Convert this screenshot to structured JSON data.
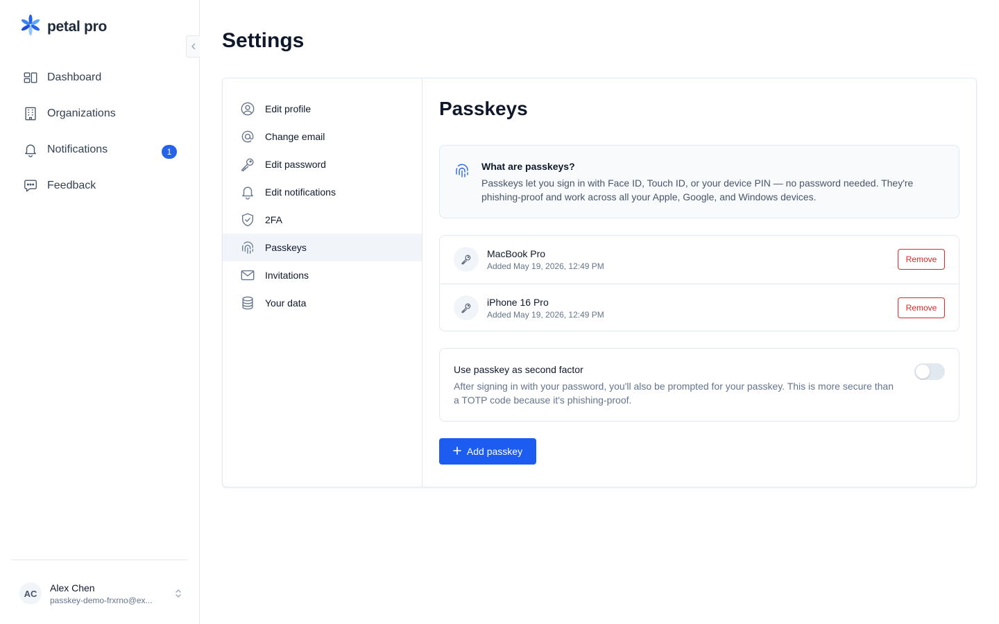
{
  "brand": {
    "name": "petal pro"
  },
  "sidebar": {
    "items": [
      {
        "label": "Dashboard",
        "icon": "dashboard-icon"
      },
      {
        "label": "Organizations",
        "icon": "building-icon"
      },
      {
        "label": "Notifications",
        "icon": "bell-icon",
        "badge": "1"
      },
      {
        "label": "Feedback",
        "icon": "chat-bubble-icon"
      }
    ]
  },
  "user": {
    "initials": "AC",
    "name": "Alex Chen",
    "email": "passkey-demo-frxrno@ex..."
  },
  "page": {
    "title": "Settings"
  },
  "settings_nav": {
    "items": [
      {
        "label": "Edit profile",
        "icon": "user-circle-icon"
      },
      {
        "label": "Change email",
        "icon": "at-sign-icon"
      },
      {
        "label": "Edit password",
        "icon": "key-icon"
      },
      {
        "label": "Edit notifications",
        "icon": "bell-icon"
      },
      {
        "label": "2FA",
        "icon": "shield-check-icon"
      },
      {
        "label": "Passkeys",
        "icon": "fingerprint-icon",
        "active": true
      },
      {
        "label": "Invitations",
        "icon": "envelope-icon"
      },
      {
        "label": "Your data",
        "icon": "database-icon"
      }
    ]
  },
  "passkeys": {
    "title": "Passkeys",
    "info": {
      "title": "What are passkeys?",
      "text": "Passkeys let you sign in with Face ID, Touch ID, or your device PIN — no password needed. They're phishing-proof and work across all your Apple, Google, and Windows devices."
    },
    "keys": [
      {
        "name": "MacBook Pro",
        "added": "Added May 19, 2026, 12:49 PM",
        "remove_label": "Remove"
      },
      {
        "name": "iPhone 16 Pro",
        "added": "Added May 19, 2026, 12:49 PM",
        "remove_label": "Remove"
      }
    ],
    "second_factor": {
      "title": "Use passkey as second factor",
      "text": "After signing in with your password, you'll also be prompted for your passkey. This is more secure than a TOTP code because it's phishing-proof.",
      "enabled": false
    },
    "add_label": "Add passkey"
  },
  "colors": {
    "accent": "#1d5cf0",
    "danger": "#dc2626",
    "badge": "#2563eb"
  }
}
